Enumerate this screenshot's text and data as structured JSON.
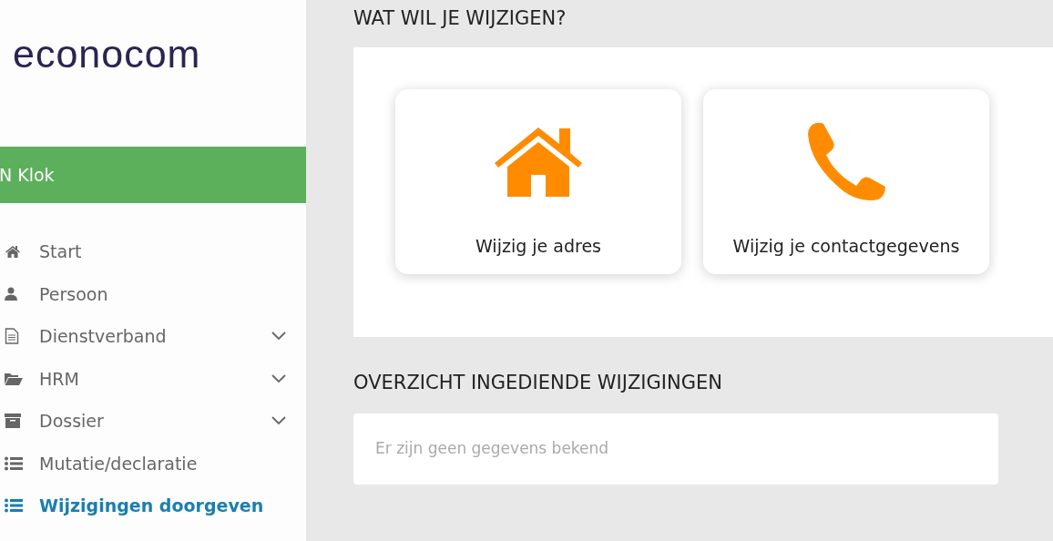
{
  "logo": "econocom",
  "user_bar": {
    "name": "N Klok"
  },
  "sidebar": {
    "items": [
      {
        "label": "Start",
        "kind": "home",
        "expandable": false,
        "selected": false
      },
      {
        "label": "Persoon",
        "kind": "user",
        "expandable": false,
        "selected": false
      },
      {
        "label": "Dienstverband",
        "kind": "document",
        "expandable": true,
        "selected": false
      },
      {
        "label": "HRM",
        "kind": "folder",
        "expandable": true,
        "selected": false
      },
      {
        "label": "Dossier",
        "kind": "archive",
        "expandable": true,
        "selected": false
      },
      {
        "label": "Mutatie/declaratie",
        "kind": "list",
        "expandable": false,
        "selected": false
      },
      {
        "label": "Wijzigingen doorgeven",
        "kind": "list",
        "expandable": false,
        "selected": true
      }
    ]
  },
  "change_section": {
    "title": "WAT WIL JE WIJZIGEN?",
    "options": [
      {
        "label": "Wijzig je adres",
        "kind": "house"
      },
      {
        "label": "Wijzig je contactgegevens",
        "kind": "phone"
      }
    ]
  },
  "overview_section": {
    "title": "OVERZICHT INGEDIENDE WIJZIGINGEN",
    "empty_message": "Er zijn geen gegevens bekend"
  }
}
